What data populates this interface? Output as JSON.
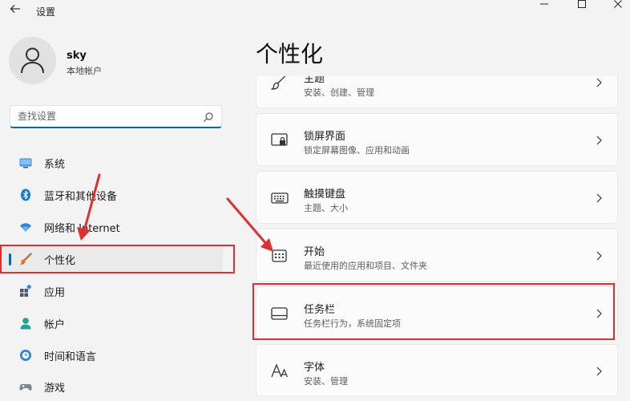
{
  "window": {
    "title": "设置",
    "back_icon": "back-arrow-icon",
    "controls": [
      "minimize-icon",
      "maximize-icon",
      "close-icon"
    ]
  },
  "user": {
    "name": "sky",
    "account_type": "本地帐户"
  },
  "search": {
    "placeholder": "查找设置",
    "value": ""
  },
  "sidebar": {
    "items": [
      {
        "label": "系统",
        "icon": "monitor-icon"
      },
      {
        "label": "蓝牙和其他设备",
        "icon": "bluetooth-icon"
      },
      {
        "label": "网络和 Internet",
        "icon": "wifi-icon"
      },
      {
        "label": "个性化",
        "icon": "brush-icon",
        "selected": true
      },
      {
        "label": "应用",
        "icon": "apps-icon"
      },
      {
        "label": "帐户",
        "icon": "account-icon"
      },
      {
        "label": "时间和语言",
        "icon": "clock-globe-icon"
      },
      {
        "label": "游戏",
        "icon": "gamepad-icon"
      }
    ]
  },
  "main": {
    "title": "个性化",
    "cards": [
      {
        "title": "主题",
        "subtitle": "安装、创建、管理",
        "icon": "brush-icon"
      },
      {
        "title": "锁屏界面",
        "subtitle": "锁定屏幕图像、应用和动画",
        "icon": "lock-screen-icon"
      },
      {
        "title": "触摸键盘",
        "subtitle": "主题、大小",
        "icon": "keyboard-icon"
      },
      {
        "title": "开始",
        "subtitle": "最近使用的应用和项目、文件夹",
        "icon": "start-menu-icon"
      },
      {
        "title": "任务栏",
        "subtitle": "任务栏行为，系统固定项",
        "icon": "taskbar-icon"
      },
      {
        "title": "字体",
        "subtitle": "安装、管理",
        "icon": "font-icon"
      }
    ]
  },
  "colors": {
    "accent": "#0067c0",
    "annotation": "#e0302d",
    "background": "#f3f3f3",
    "card": "#fbfbfb"
  }
}
